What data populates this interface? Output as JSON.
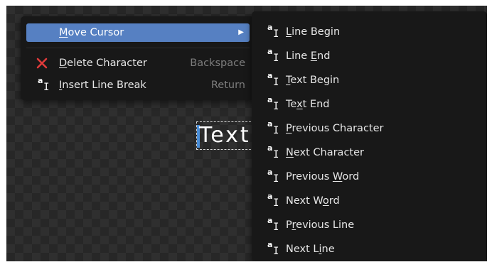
{
  "viewport": {
    "text_object": "Text"
  },
  "main_menu": {
    "items": [
      {
        "label_prefix": "",
        "label_key": "M",
        "label_rest": "ove Cursor",
        "shortcut": "",
        "submenu_arrow": "▶",
        "icon": "none",
        "highlighted": true
      },
      {
        "label_prefix": "",
        "label_key": "D",
        "label_rest": "elete Character",
        "shortcut": "Backspace",
        "icon": "delete-x-icon",
        "highlighted": false
      },
      {
        "label_prefix": "",
        "label_key": "I",
        "label_rest": "nsert Line Break",
        "shortcut": "Return",
        "icon": "text-cursor-icon",
        "highlighted": false
      }
    ]
  },
  "sub_menu": {
    "icon_glyph_a": "a",
    "icon_glyph_i": "I",
    "items": [
      {
        "pre": "",
        "key": "L",
        "post": "ine Begin"
      },
      {
        "pre": "Line ",
        "key": "E",
        "post": "nd"
      },
      {
        "pre": "",
        "key": "T",
        "post": "ext Begin"
      },
      {
        "pre": "Te",
        "key": "x",
        "post": "t End"
      },
      {
        "pre": "",
        "key": "P",
        "post": "revious Character"
      },
      {
        "pre": "",
        "key": "N",
        "post": "ext Character"
      },
      {
        "pre": "Previous ",
        "key": "W",
        "post": "ord"
      },
      {
        "pre": "Next W",
        "key": "o",
        "post": "rd"
      },
      {
        "pre": "P",
        "key": "r",
        "post": "evious Line"
      },
      {
        "pre": "Next L",
        "key": "i",
        "post": "ne"
      }
    ]
  },
  "colors": {
    "highlight": "#5680c2",
    "menu_bg": "#181818",
    "delete_icon": "#e03b3b",
    "cursor": "#4a8ed8"
  }
}
